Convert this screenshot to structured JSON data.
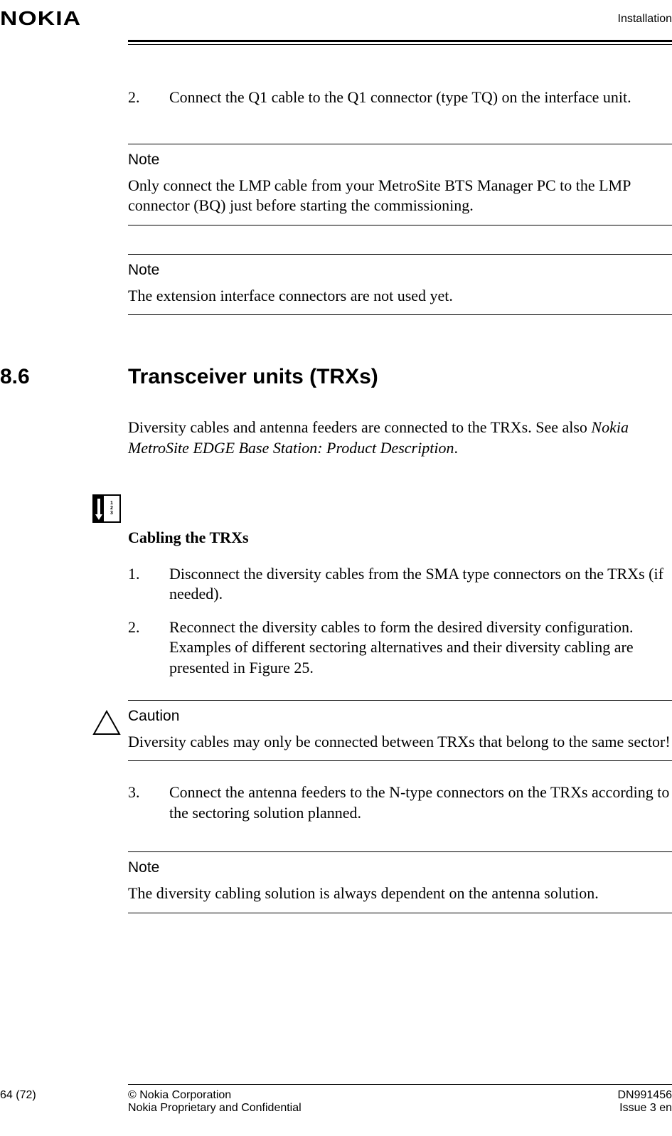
{
  "header": {
    "logo": "NOKIA",
    "right": "Installation"
  },
  "top_step": {
    "num": "2.",
    "text": "Connect the Q1 cable to the Q1 connector (type TQ) on the interface unit."
  },
  "note1": {
    "title": "Note",
    "text": "Only connect the LMP cable from your MetroSite BTS Manager PC to the LMP connector (BQ) just before starting the commissioning."
  },
  "note2": {
    "title": "Note",
    "text": "The extension interface connectors are not used yet."
  },
  "section": {
    "num": "8.6",
    "title": "Transceiver units (TRXs)"
  },
  "intro": {
    "pre": "Diversity cables and antenna feeders are connected to the TRXs. See also ",
    "italic": "Nokia MetroSite EDGE Base Station: Product Description",
    "post": "."
  },
  "procedure": {
    "icon_labels": [
      "1",
      "2",
      "3"
    ],
    "title": "Cabling the TRXs",
    "steps": [
      {
        "num": "1.",
        "text": "Disconnect the diversity cables from the SMA type connectors on the TRXs (if needed)."
      },
      {
        "num": "2.",
        "text": "Reconnect the diversity cables to form the desired diversity configuration. Examples of different sectoring alternatives and their diversity cabling are presented in Figure 25."
      }
    ]
  },
  "caution": {
    "title": "Caution",
    "text": "Diversity cables may only be connected between TRXs that belong to the same sector!"
  },
  "step3": {
    "num": "3.",
    "text": "Connect the antenna feeders to the N-type connectors on the TRXs according to the sectoring solution planned."
  },
  "note3": {
    "title": "Note",
    "text": "The diversity cabling solution is always dependent on the antenna solution."
  },
  "footer": {
    "page": "64 (72)",
    "copyright": "© Nokia Corporation",
    "confidential": "Nokia Proprietary and Confidential",
    "docnum": "DN991456",
    "issue": "Issue 3 en"
  }
}
